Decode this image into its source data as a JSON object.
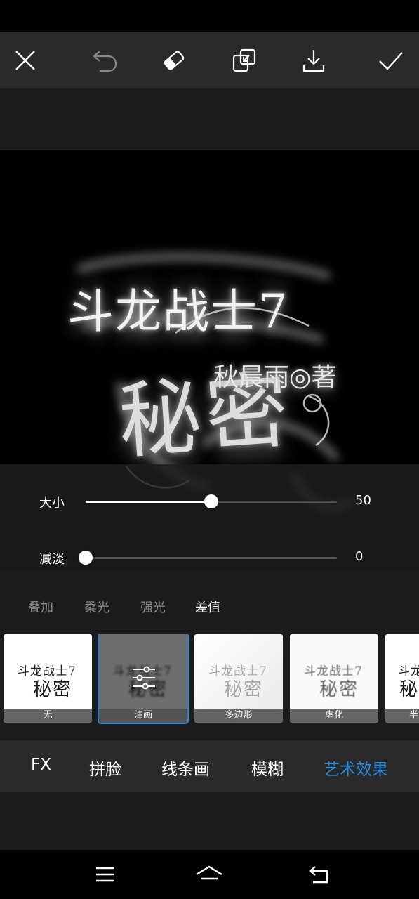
{
  "toolbar": {
    "icons": [
      "close-icon",
      "undo-icon",
      "eraser-icon",
      "compare-icon",
      "download-icon",
      "check-icon"
    ]
  },
  "canvas": {
    "title_line_1": "斗龙战士7",
    "title_line_2": "秋晨雨◎著",
    "title_line_3": "秘密"
  },
  "sliders": {
    "size": {
      "label": "大小",
      "value": "50",
      "fraction": 0.5
    },
    "fade": {
      "label": "减淡",
      "value": "0",
      "fraction": 0.0
    }
  },
  "blend_modes": {
    "items": [
      "叠加",
      "柔光",
      "强光",
      "差值"
    ],
    "active": "差值"
  },
  "effects": {
    "items": [
      {
        "label": "无"
      },
      {
        "label": "油画"
      },
      {
        "label": "多边形"
      },
      {
        "label": "虚化"
      },
      {
        "label": "半"
      }
    ],
    "selected": "油画"
  },
  "categories": {
    "items": [
      "FX",
      "拼脸",
      "线条画",
      "模糊",
      "艺术效果"
    ],
    "active": "艺术效果"
  },
  "colors": {
    "accent": "#2a86d6",
    "toolbar_bg": "#2a2a2a",
    "panel_bg": "#1c1c1c"
  },
  "navbar": {
    "icons": [
      "menu-icon",
      "home-icon",
      "back-icon"
    ]
  }
}
